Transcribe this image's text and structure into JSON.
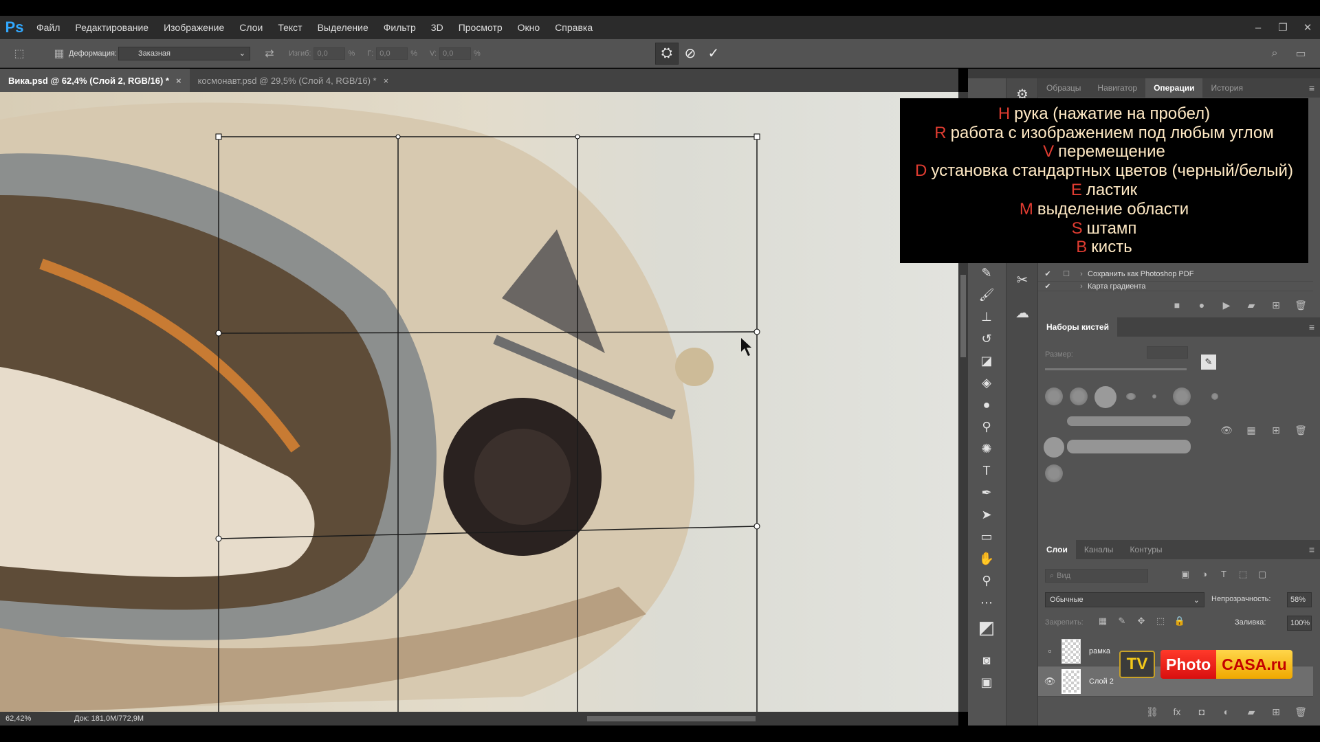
{
  "menubar": {
    "logo": "Ps",
    "items": [
      "Файл",
      "Редактирование",
      "Изображение",
      "Слои",
      "Текст",
      "Выделение",
      "Фильтр",
      "3D",
      "Просмотр",
      "Окно",
      "Справка"
    ],
    "window_controls": [
      "–",
      "❐",
      "✕"
    ]
  },
  "optionsbar": {
    "warp_label": "Деформация:",
    "warp_value": "Заказная",
    "bend_label": "Изгиб:",
    "bend_value": "0,0",
    "h_label": "Г:",
    "h_value": "0,0",
    "v_label": "V:",
    "v_value": "0,0",
    "percent": "%"
  },
  "tabs": [
    {
      "label": "Вика.psd @ 62,4% (Слой 2, RGB/16) *",
      "close": "×"
    },
    {
      "label": "космонавт.psd @ 29,5% (Слой 4, RGB/16) *",
      "close": "×"
    }
  ],
  "status": {
    "zoom": "62,42%",
    "doc": "Док: 181,0M/772,9M"
  },
  "panels": {
    "top_tabs": [
      "Образцы",
      "Навигатор",
      "Операции",
      "История"
    ],
    "actions": [
      {
        "label": "Сохранить как Photoshop PDF"
      },
      {
        "label": "Карта градиента"
      }
    ],
    "brushes_title": "Наборы кистей",
    "brush_size_label": "Размер:",
    "layers_tabs": [
      "Слои",
      "Каналы",
      "Контуры"
    ],
    "layer_filter": "Вид",
    "blend_mode": "Обычные",
    "opacity_label": "Непрозрачность:",
    "opacity_value": "58%",
    "lock_label": "Закрепить:",
    "fill_label": "Заливка:",
    "fill_value": "100%",
    "layers": [
      {
        "name": "рамка"
      },
      {
        "name": "Слой 2"
      }
    ]
  },
  "overlay": [
    {
      "key": "H",
      "text": "рука (нажатие на пробел)"
    },
    {
      "key": "R",
      "text": "работа с изображением под любым углом"
    },
    {
      "key": "V",
      "text": "перемещение"
    },
    {
      "key": "D",
      "text": "установка стандартных цветов (черный/белый)"
    },
    {
      "key": "E",
      "text": "ластик"
    },
    {
      "key": "M",
      "text": "выделение области"
    },
    {
      "key": "S",
      "text": "штамп"
    },
    {
      "key": "B",
      "text": "кисть"
    }
  ],
  "watermark": {
    "tv": "TV",
    "photo": "Photo",
    "casa": "CASA.ru"
  },
  "colors": {
    "overlay_key": "#e03c31",
    "overlay_text": "#ffe9c4",
    "ps_blue": "#31a8ff"
  }
}
